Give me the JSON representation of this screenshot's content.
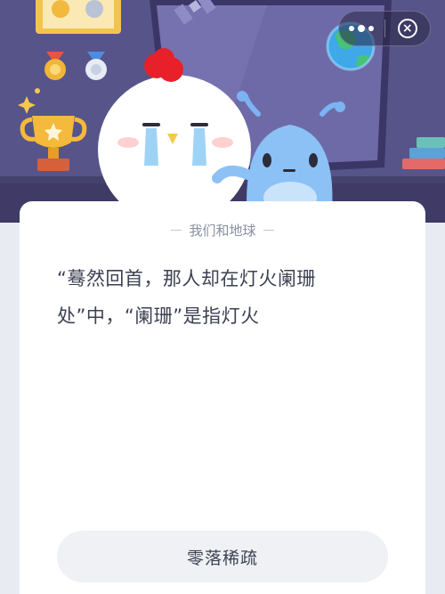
{
  "header": {
    "controls": {
      "more_icon": "more-dots-icon",
      "close_icon": "close-circle-icon",
      "close_glyph": "×"
    },
    "illustration": {
      "elements": [
        "medal-icon",
        "trophy-icon",
        "chicken-mascot",
        "alien-mascot",
        "earth-globe",
        "satellite-icon",
        "books-icon"
      ]
    }
  },
  "quiz": {
    "topic": "我们和地球",
    "question": "“蓦然回首，那人却在灯火阑珊处”中，“阑珊”是指灯火",
    "options": [
      {
        "label": "零落稀疏"
      }
    ]
  },
  "colors": {
    "hero_bg": "#55517f",
    "card_bg": "#ffffff",
    "text": "#3c4152",
    "muted": "#8a8fa0",
    "button_bg": "#eff1f5"
  }
}
